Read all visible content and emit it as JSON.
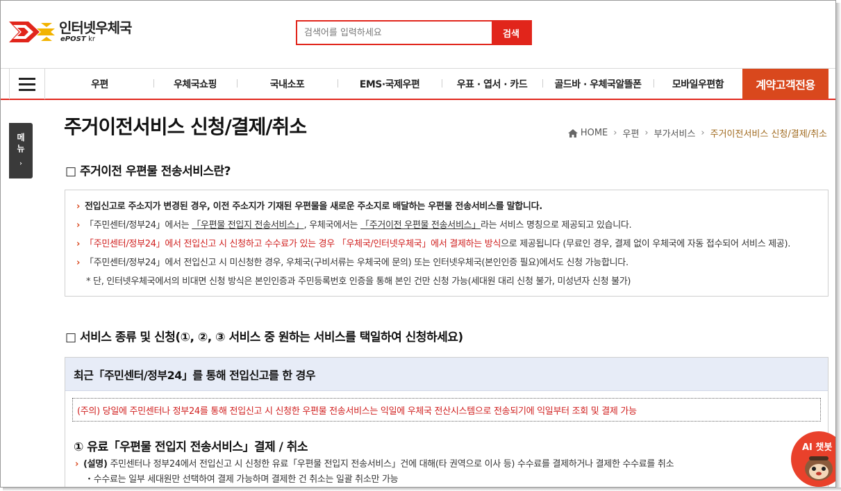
{
  "header": {
    "logo_title": "인터넷우체국",
    "logo_sub_brand": "ePOST",
    "logo_sub_domain": "kr",
    "search_placeholder": "검색어를 입력하세요",
    "search_button": "검색"
  },
  "nav": {
    "items": [
      "우편",
      "우체국쇼핑",
      "국내소포",
      "EMS·국제우편",
      "우표 · 엽서 · 카드",
      "골드바 · 우체국알뜰폰",
      "모바일우편함"
    ],
    "cta": "계약고객전용"
  },
  "side_tab": {
    "label_1": "메",
    "label_2": "뉴",
    "arrow": "›"
  },
  "page": {
    "title": "주거이전서비스 신청/결제/취소",
    "breadcrumb": [
      "HOME",
      "우편",
      "부가서비스",
      "주거이전서비스 신청/결제/취소"
    ]
  },
  "section1": {
    "title": "□ 주거이전 우편물 전송서비스란?",
    "line1": "전입신고로 주소지가 변경된 경우, 이전 주소지가 기재된 우편물을 새로운 주소지로 배달하는 우편물 전송서비스를 말합니다.",
    "line2_a": "「주민센터/정부24」에서는 ",
    "line2_b": "「우편물 전입지 전송서비스」",
    "line2_c": ", 우체국에서는 ",
    "line2_d": "「주거이전 우편물 전송서비스」",
    "line2_e": "라는 서비스 명칭으로 제공되고 있습니다.",
    "line3_a": "「주민센터/정부24」에서 전입신고 시 신청하고 수수료가 있는 경우 「우체국/인터넷우체국」에서 결제하는 방식",
    "line3_b": "으로 제공됩니다 (무료인 경우, 결제 없이 우체국에 자동 접수되어 서비스 제공).",
    "line4": "「주민센터/정부24」에서 전입신고 시 미신청한 경우, 우체국(구비서류는 우체국에 문의) 또는 인터넷우체국(본인인증 필요)에서도 신청 가능합니다.",
    "note": "* 단, 인터넷우체국에서의 비대면 신청 방식은 본인인증과 주민등록번호 인증을 통해 본인 건만 신청 가능(세대원 대리 신청 불가, 미성년자 신청 불가)"
  },
  "section2": {
    "title": "□ 서비스 종류 및 신청(①, ②, ③ 서비스 중 원하는 서비스를 택일하여 신청하세요)",
    "panel_title": "최근「주민센터/정부24」를 통해 전입신고를 한 경우",
    "caution": "(주의) 당일에 주민센터나 정부24를 통해 전입신고 시 신청한 우편물 전송서비스는 익일에 우체국 전산시스템으로 전송되기에 익일부터 조회 및 결제 가능",
    "sub_title": "① 유료「우편물 전입지 전송서비스」결제 / 취소",
    "desc_label": "(설명)",
    "desc_text": " 주민센터나 정부24에서 전입신고 시 신청한 유료「우편물 전입지 전송서비스」건에 대해(타 권역으로 이사 등) 수수료를 결제하거나 결제한 수수료를 취소",
    "desc_sub": "・수수료는 일부 세대원만 선택하여 결제 가능하며 결제한 건 취소는 일괄 취소만 가능"
  },
  "chatbot": {
    "label": "AI 챗봇"
  },
  "colors": {
    "brand_red": "#e1251b",
    "cta_orange": "#d9481d",
    "panel_blue": "#e7ecf7",
    "breadcrumb_current": "#a06a1f"
  }
}
